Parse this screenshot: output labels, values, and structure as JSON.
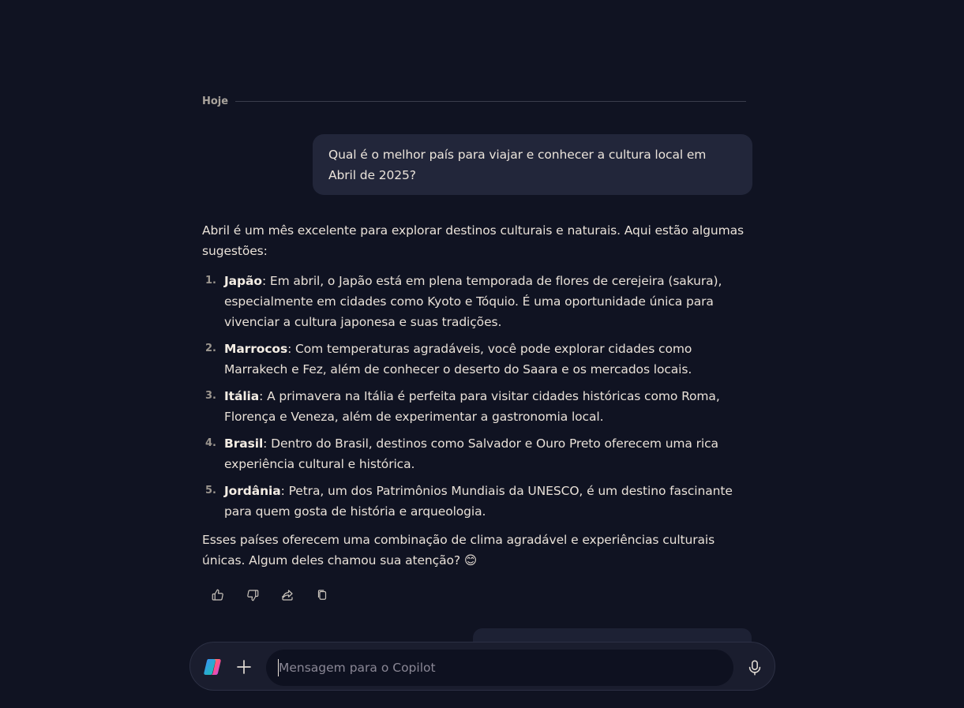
{
  "chat": {
    "date_label": "Hoje",
    "user_message": "Qual é o melhor país para viajar e conhecer a cultura local em Abril de 2025?",
    "answer": {
      "intro": "Abril é um mês excelente para explorar destinos culturais e naturais. Aqui estão algumas sugestões:",
      "items": [
        {
          "num": "1.",
          "country": "Japão",
          "text": ": Em abril, o Japão está em plena temporada de flores de cerejeira (sakura), especialmente em cidades como Kyoto e Tóquio. É uma oportunidade única para vivenciar a cultura japonesa e suas tradições."
        },
        {
          "num": "2.",
          "country": "Marrocos",
          "text": ": Com temperaturas agradáveis, você pode explorar cidades como Marrakech e Fez, além de conhecer o deserto do Saara e os mercados locais."
        },
        {
          "num": "3.",
          "country": "Itália",
          "text": ": A primavera na Itália é perfeita para visitar cidades históricas como Roma, Florença e Veneza, além de experimentar a gastronomia local."
        },
        {
          "num": "4.",
          "country": "Brasil",
          "text": ": Dentro do Brasil, destinos como Salvador e Ouro Preto oferecem uma rica experiência cultural e histórica."
        },
        {
          "num": "5.",
          "country": "Jordânia",
          "text": ": Petra, um dos Patrimônios Mundiais da UNESCO, é um destino fascinante para quem gosta de história e arqueologia."
        }
      ],
      "outro": "Esses países oferecem uma combinação de clima agradável e experiências culturais únicas. Algum deles chamou sua atenção? 😊"
    },
    "actions": [
      "thumbs-up-icon",
      "thumbs-down-icon",
      "share-icon",
      "copy-icon"
    ]
  },
  "composer": {
    "placeholder": "Mensagem para o Copilot",
    "value": ""
  },
  "colors": {
    "background": "#101322",
    "user_bubble": "#22263a",
    "composer": "#1a1d2e",
    "text": "#e9e1d8"
  }
}
